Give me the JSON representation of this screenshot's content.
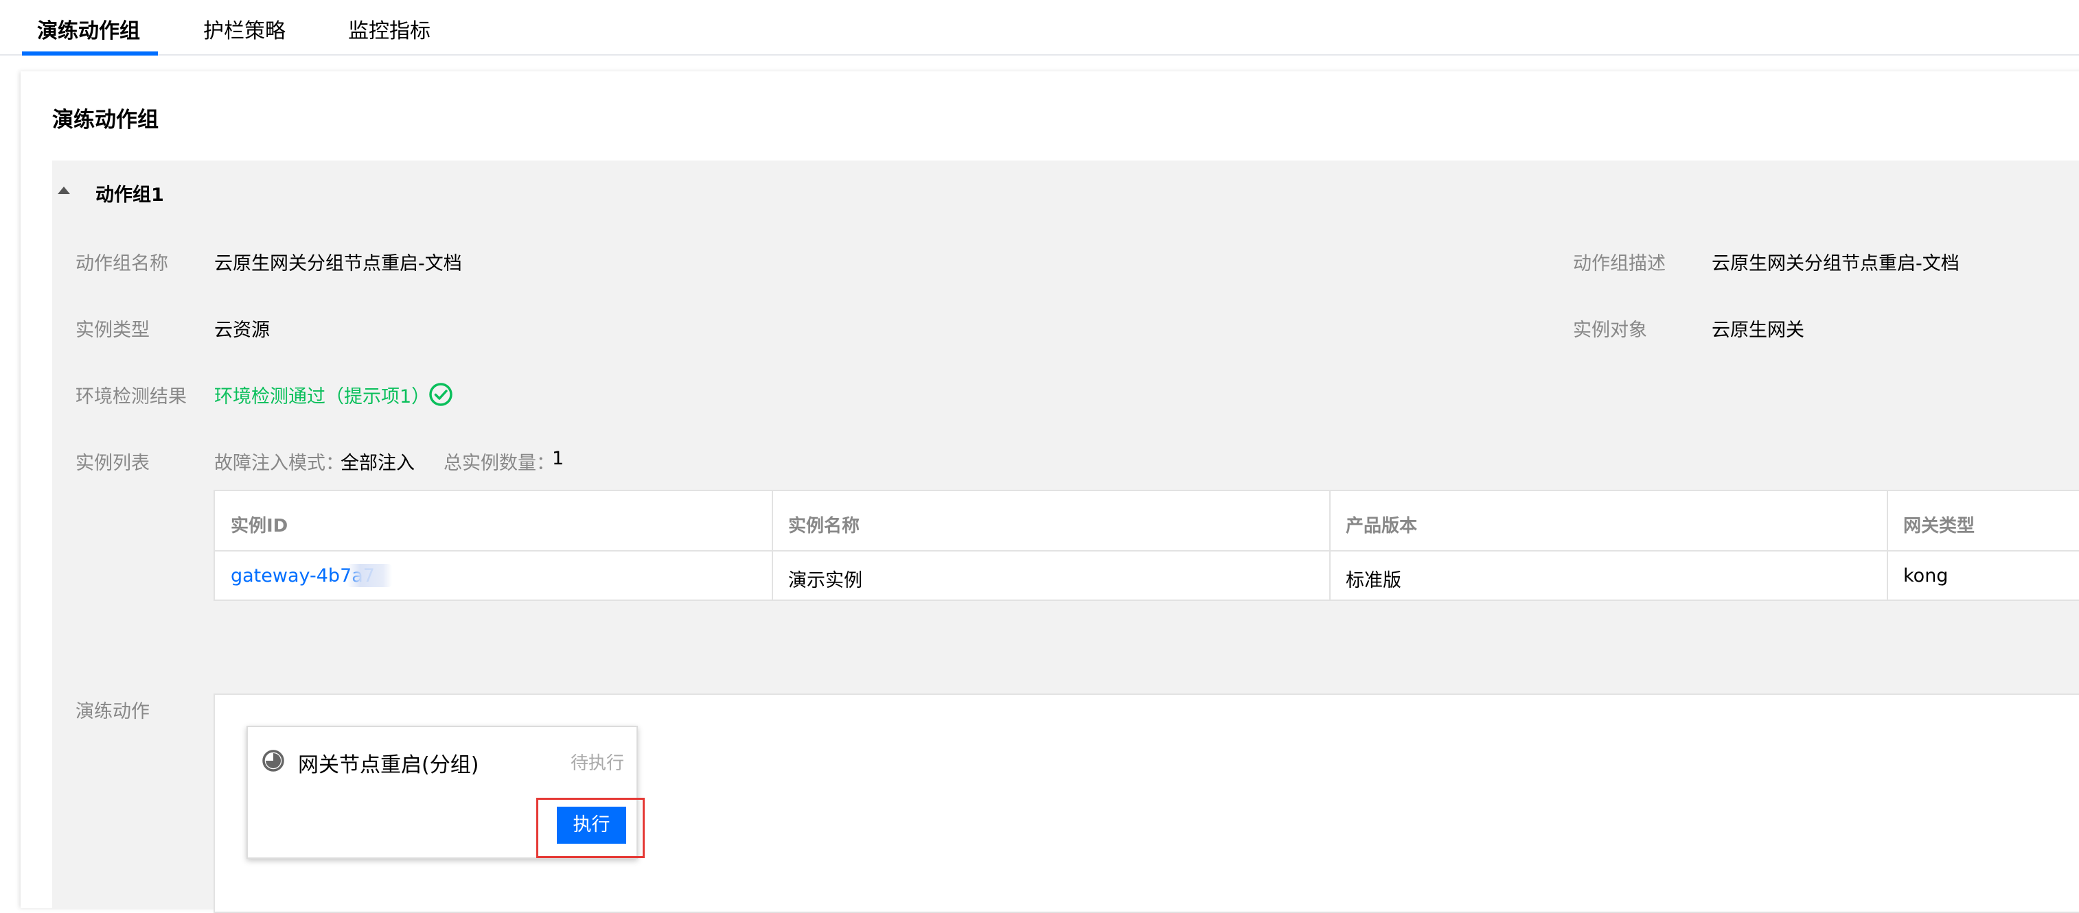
{
  "tabs": [
    {
      "label": "演练动作组",
      "active": true
    },
    {
      "label": "护栏策略",
      "active": false
    },
    {
      "label": "监控指标",
      "active": false
    }
  ],
  "section_title": "演练动作组",
  "group": {
    "name": "动作组1",
    "fields": {
      "name_label": "动作组名称",
      "name_value": "云原生网关分组节点重启-文档",
      "desc_label": "动作组描述",
      "desc_value": "云原生网关分组节点重启-文档",
      "type_label": "实例类型",
      "type_value": "云资源",
      "target_label": "实例对象",
      "target_value": "云原生网关",
      "env_label": "环境检测结果",
      "env_value": "环境检测通过（提示项1）",
      "list_label": "实例列表",
      "mode_label": "故障注入模式：",
      "mode_value": "全部注入",
      "count_label": "总实例数量：",
      "count_value": "1"
    },
    "instance_table": {
      "headers": [
        "实例ID",
        "实例名称",
        "产品版本",
        "网关类型"
      ],
      "rows": [
        [
          "gateway-4b7a7",
          "演示实例",
          "标准版",
          "kong"
        ]
      ]
    },
    "actions_label": "演练动作",
    "action": {
      "icon": "progress-pie-icon",
      "name": "网关节点重启(分组)",
      "status": "待执行",
      "button": "执行"
    }
  },
  "colors": {
    "accent": "#006eff",
    "success": "#0abf5b",
    "highlight": "#e53935",
    "panel_bg": "#f2f2f2"
  }
}
